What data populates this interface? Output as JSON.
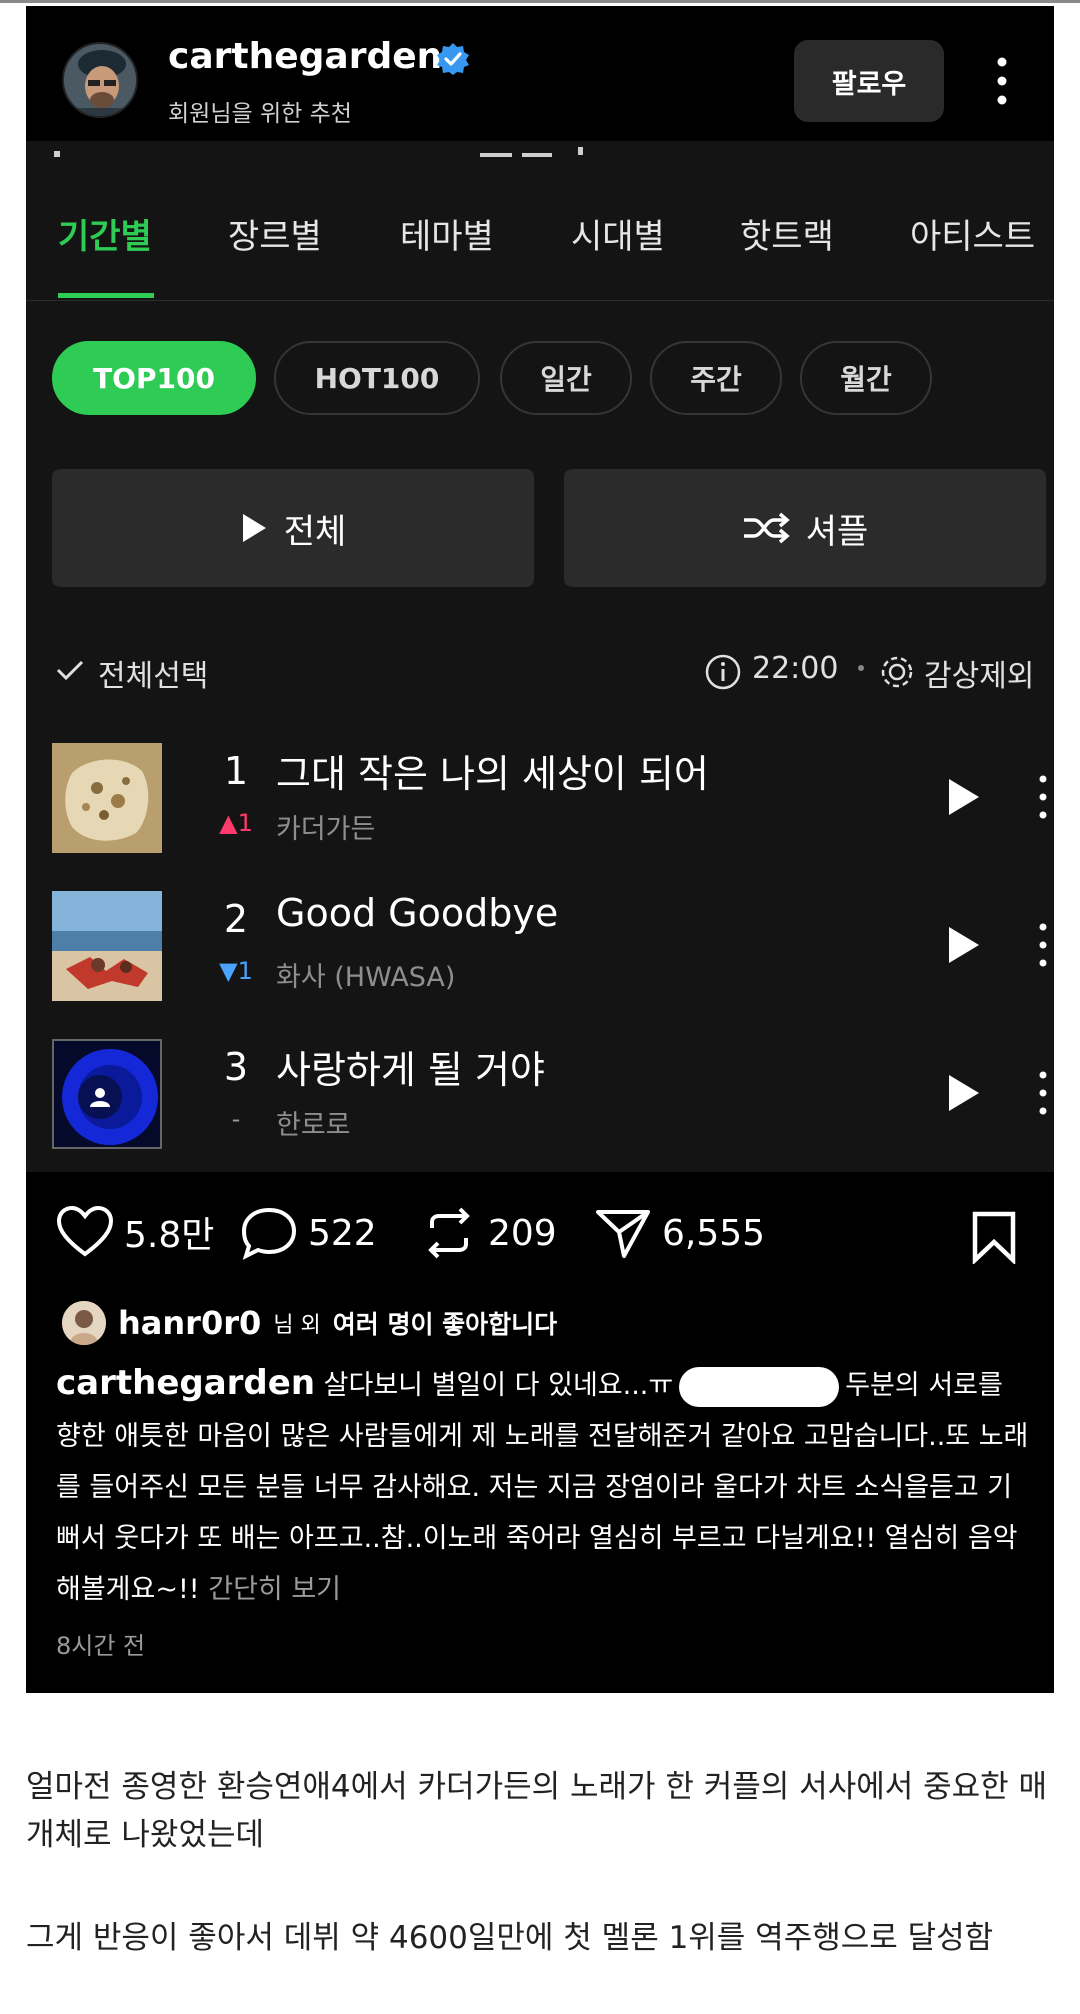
{
  "post": {
    "username": "carthegarden",
    "subtitle": "회원님을 위한 추천",
    "follow_label": "팔로우",
    "app": {
      "tabs": [
        "기간별",
        "장르별",
        "테마별",
        "시대별",
        "핫트랙",
        "아티스트"
      ],
      "chips": [
        "TOP100",
        "HOT100",
        "일간",
        "주간",
        "월간"
      ],
      "play_all_label": "전체",
      "shuffle_label": "셔플",
      "select_all_label": "전체선택",
      "time": "22:00",
      "exclude_label": "감상제외",
      "songs": [
        {
          "rank": "1",
          "delta": "▲1",
          "title": "그대 작은 나의 세상이 되어",
          "artist": "카더가든"
        },
        {
          "rank": "2",
          "delta": "▼1",
          "title": "Good Goodbye",
          "artist": "화사 (HWASA)"
        },
        {
          "rank": "3",
          "delta": "-",
          "title": "사랑하게 될 거야",
          "artist": "한로로"
        }
      ]
    },
    "likes_count": "5.8만",
    "comments_count": "522",
    "reposts_count": "209",
    "shares_count": "6,555",
    "liked_by": {
      "user": "hanr0r0",
      "suffix": "님 외",
      "rest": "여러 명이 좋아합니다"
    },
    "caption": {
      "user": "carthegarden",
      "part1": "살다보니 별일이 다 있네요...ㅠ",
      "part2": "두분의 서로를 향한 애틋한 마음이 많은 사람들에게 제 노래를 전달해준거 같아요 고맙습니다..또 노래를 들어주신 모든 분들 너무 감사해요. 저는 지금 장염이라 울다가 차트 소식을듣고 기뻐서 웃다가 또 배는 아프고..참..이노래 죽어라 열심히 부르고 다닐게요!! 열심히 음악해볼게요~!!",
      "more": "간단히 보기"
    },
    "timestamp": "8시간 전"
  },
  "article": {
    "para1": "얼마전 종영한 환승연애4에서 카더가든의 노래가 한 커플의 서사에서 중요한 매개체로 나왔었는데",
    "para2": "그게 반응이 좋아서 데뷔 약 4600일만에 첫 멜론 1위를 역주행으로 달성함"
  },
  "colors": {
    "accent_green": "#2ecc55",
    "rank_up": "#ff3b6b",
    "rank_down": "#4aa3ff",
    "verified_blue": "#3897f0"
  }
}
